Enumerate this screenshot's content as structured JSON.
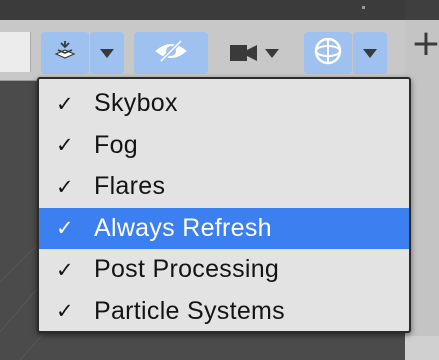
{
  "toolbar": {
    "buttons": [
      {
        "name": "gizmo-toggle",
        "icon": "layers-stack-icon",
        "active": true
      },
      {
        "name": "scene-visibility",
        "icon": "eye-slash-icon",
        "active": true
      },
      {
        "name": "camera",
        "icon": "video-camera-icon",
        "active": false
      },
      {
        "name": "draw-mode",
        "icon": "globe-gizmo-icon",
        "active": true
      }
    ],
    "plus_label": "+"
  },
  "menu": {
    "check_glyph": "✓",
    "items": [
      {
        "label": "Skybox",
        "checked": true
      },
      {
        "label": "Fog",
        "checked": true
      },
      {
        "label": "Flares",
        "checked": true
      },
      {
        "label": "Always Refresh",
        "checked": true,
        "highlighted": true
      },
      {
        "label": "Post Processing",
        "checked": true
      },
      {
        "label": "Particle Systems",
        "checked": true
      }
    ]
  },
  "colors": {
    "highlight": "#3c7ff0",
    "active_button": "#9ec1ef",
    "menu_background": "#e3e3e3"
  }
}
